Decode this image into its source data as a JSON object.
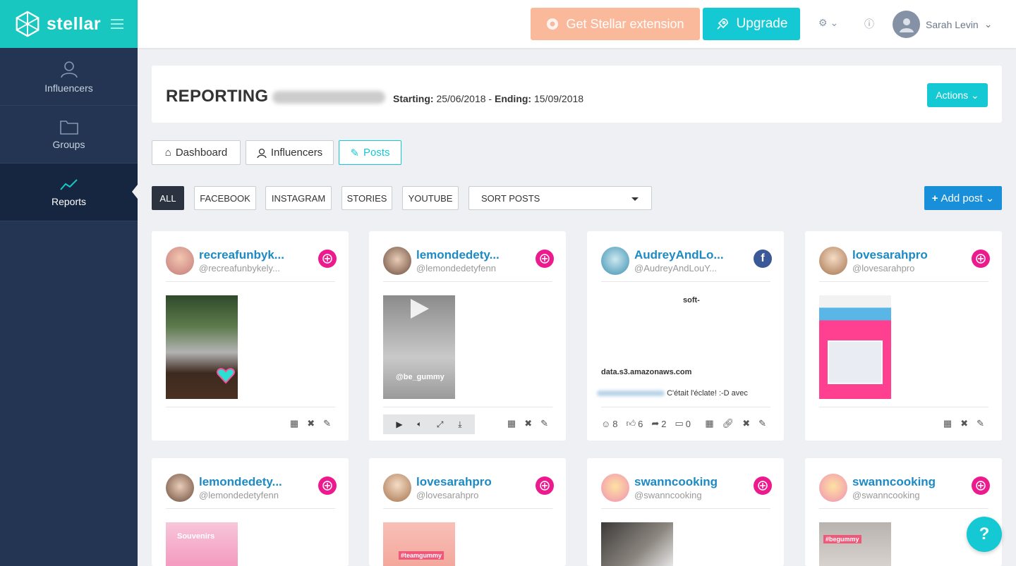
{
  "brand": {
    "name": "stellar"
  },
  "sidebar": {
    "items": [
      {
        "label": "Influencers",
        "icon": "user-icon"
      },
      {
        "label": "Groups",
        "icon": "folder-icon"
      },
      {
        "label": "Reports",
        "icon": "chart-line-icon",
        "active": true
      }
    ]
  },
  "topbar": {
    "extension_label": "Get Stellar extension",
    "upgrade_label": "Upgrade",
    "user_name": "Sarah Levin"
  },
  "report": {
    "title": "REPORTING",
    "starting_label": "Starting:",
    "starting": "25/06/2018",
    "separator": "-",
    "ending_label": "Ending:",
    "ending": "15/09/2018",
    "actions_label": "Actions"
  },
  "tabs": [
    {
      "label": "Dashboard"
    },
    {
      "label": "Influencers"
    },
    {
      "label": "Posts",
      "active": true
    }
  ],
  "filters": [
    "ALL",
    "FACEBOOK",
    "INSTAGRAM",
    "STORIES",
    "YOUTUBE"
  ],
  "sort": {
    "label": "SORT POSTS"
  },
  "add_post_label": "Add post",
  "posts": [
    {
      "name": "recreafunbyk...",
      "handle": "@recreafunbykely...",
      "network": "instagram"
    },
    {
      "name": "lemondedety...",
      "handle": "@lemondedetyfenn",
      "network": "instagram",
      "media_text": "@be_gummy"
    },
    {
      "name": "AudreyAndLo...",
      "handle": "@AudreyAndLouY...",
      "network": "facebook",
      "text_top": "soft-",
      "text_domain": "data.s3.amazonaws.com",
      "text_caption": "C'était l'éclate! :-D avec",
      "stats": {
        "reactions": "8",
        "likes": "6",
        "shares": "2",
        "comments": "0"
      }
    },
    {
      "name": "lovesarahpro",
      "handle": "@lovesarahpro",
      "network": "instagram"
    },
    {
      "name": "lemondedety...",
      "handle": "@lemondedetyfenn",
      "network": "instagram",
      "media_text": "Souvenirs"
    },
    {
      "name": "lovesarahpro",
      "handle": "@lovesarahpro",
      "network": "instagram",
      "media_text": "#teamgummy"
    },
    {
      "name": "swanncooking",
      "handle": "@swanncooking",
      "network": "instagram"
    },
    {
      "name": "swanncooking",
      "handle": "@swanncooking",
      "network": "instagram",
      "media_text": "#begummy"
    }
  ],
  "help_label": "?",
  "colors": {
    "accent": "#14c9d3",
    "brand": "#18c7c0",
    "sidebar": "#233552",
    "instagram": "#ec1a8c",
    "facebook": "#3b5998",
    "link": "#1c8ac4"
  }
}
